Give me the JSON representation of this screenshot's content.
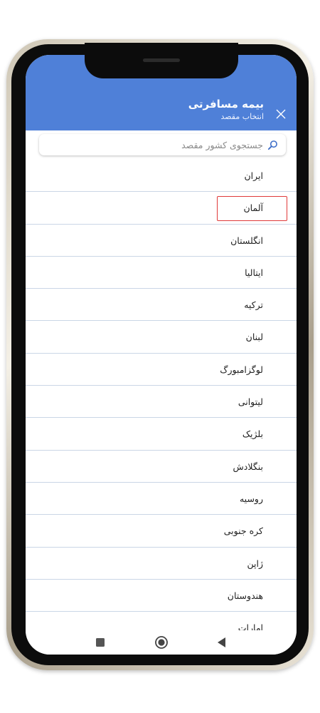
{
  "header": {
    "title": "بیمه مسافرتی",
    "subtitle": "انتخاب مقصد",
    "close_icon": "close-icon",
    "color": "#4f80d8"
  },
  "search": {
    "placeholder": "جستجوی کشور مقصد",
    "value": "",
    "icon": "search-icon"
  },
  "countries": [
    "ایران",
    "آلمان",
    "انگلستان",
    "ایتالیا",
    "ترکیه",
    "لبنان",
    "لوگزامبورگ",
    "لیتوانی",
    "بلژیک",
    "بنگلادش",
    "روسیه",
    "کره جنوبی",
    "ژاپن",
    "هندوستان",
    "امارات"
  ],
  "highlighted_item": "آلمان",
  "highlight_color": "#e03a3a",
  "navbar": {
    "recents_icon": "square-icon",
    "home_icon": "circle-home-icon",
    "back_icon": "triangle-back-icon"
  }
}
